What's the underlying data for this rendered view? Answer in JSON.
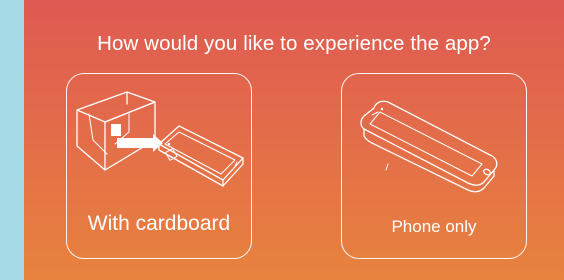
{
  "prompt": {
    "title": "How would you like to experience the app?"
  },
  "options": [
    {
      "id": "cardboard",
      "label": "With cardboard",
      "icon": "cardboard-viewer-with-phone-icon"
    },
    {
      "id": "phone",
      "label": "Phone only",
      "icon": "smartphone-icon"
    }
  ],
  "colors": {
    "gradient_top": "#df5a52",
    "gradient_bottom": "#e8833e",
    "outside_background": "#a6d9e6",
    "foreground": "#ffffff"
  }
}
